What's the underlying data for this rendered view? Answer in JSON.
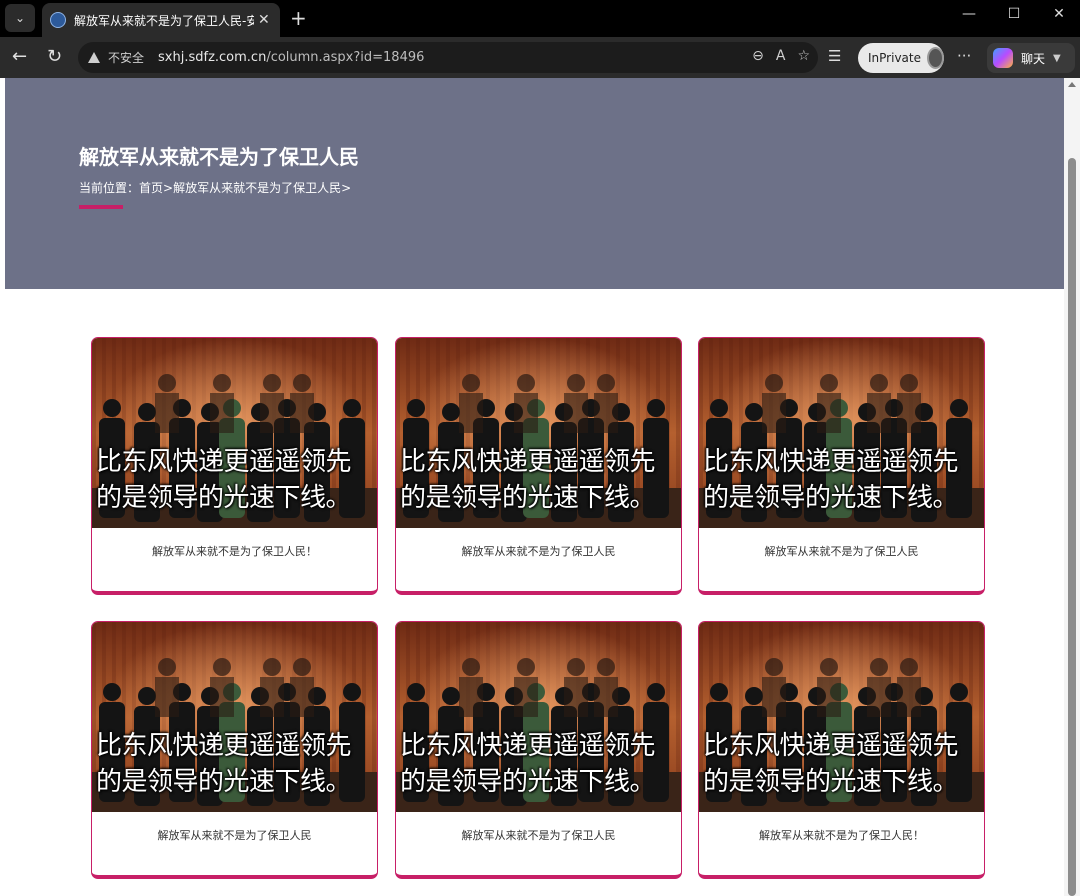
{
  "browser": {
    "tab_title": "解放军从来就不是为了保卫人民-安",
    "tab_close": "✕",
    "new_tab": "+",
    "insecure_label": "不安全",
    "url_host": "sxhj.sdfz.com.cn",
    "url_path": "/column.aspx?id=18496",
    "inprivate_label": "InPrivate",
    "chat_label": "聊天",
    "icons": [
      "tab-actions-icon",
      "favicon-icon",
      "close-icon",
      "new-tab-icon",
      "minimize-icon",
      "maximize-icon",
      "close-window-icon",
      "back-icon",
      "refresh-icon",
      "warning-icon",
      "zoom-icon",
      "read-aloud-icon",
      "favorite-star-icon",
      "favorites-icon",
      "more-icon",
      "copilot-icon"
    ]
  },
  "hero": {
    "title": "解放军从来就不是为了保卫人民",
    "breadcrumb_label": "当前位置：",
    "breadcrumb_home": "首页",
    "breadcrumb_sep": ">",
    "breadcrumb_current": "解放军从来就不是为了保卫人民>",
    "accent_color": "#c71f67",
    "background_color": "#6d7188"
  },
  "cards": [
    {
      "line1": "比东风快递更遥遥领先",
      "line2": "的是领导的光速下线。",
      "caption": "解放军从来就不是为了保卫人民！"
    },
    {
      "line1": "比东风快递更遥遥领先",
      "line2": "的是领导的光速下线。",
      "caption": "解放军从来就不是为了保卫人民"
    },
    {
      "line1": "比东风快递更遥遥领先",
      "line2": "的是领导的光速下线。",
      "caption": "解放军从来就不是为了保卫人民"
    },
    {
      "line1": "比东风快递更遥遥领先",
      "line2": "的是领导的光速下线。",
      "caption": "解放军从来就不是为了保卫人民"
    },
    {
      "line1": "比东风快递更遥遥领先",
      "line2": "的是领导的光速下线。",
      "caption": "解放军从来就不是为了保卫人民"
    },
    {
      "line1": "比东风快递更遥遥领先",
      "line2": "的是领导的光速下线。",
      "caption": "解放军从来就不是为了保卫人民！"
    }
  ]
}
